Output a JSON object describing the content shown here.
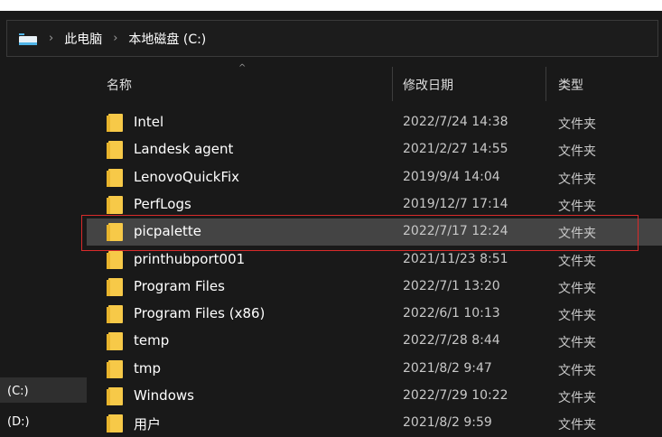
{
  "breadcrumb": {
    "items": [
      "此电脑",
      "本地磁盘 (C:)"
    ]
  },
  "columns": {
    "name": "名称",
    "date": "修改日期",
    "type": "类型"
  },
  "sidebar": {
    "drives": [
      "(C:)",
      "(D:)"
    ]
  },
  "files": [
    {
      "name": "Intel",
      "date": "2022/7/24 14:38",
      "type": "文件夹"
    },
    {
      "name": "Landesk agent",
      "date": "2021/2/27 14:55",
      "type": "文件夹"
    },
    {
      "name": "LenovoQuickFix",
      "date": "2019/9/4 14:04",
      "type": "文件夹"
    },
    {
      "name": "PerfLogs",
      "date": "2019/12/7 17:14",
      "type": "文件夹"
    },
    {
      "name": "picpalette",
      "date": "2022/7/17 12:24",
      "type": "文件夹"
    },
    {
      "name": "printhubport001",
      "date": "2021/11/23 8:51",
      "type": "文件夹"
    },
    {
      "name": "Program Files",
      "date": "2022/7/1 13:20",
      "type": "文件夹"
    },
    {
      "name": "Program Files (x86)",
      "date": "2022/6/1 10:13",
      "type": "文件夹"
    },
    {
      "name": "temp",
      "date": "2022/7/28 8:44",
      "type": "文件夹"
    },
    {
      "name": "tmp",
      "date": "2021/8/2 9:47",
      "type": "文件夹"
    },
    {
      "name": "Windows",
      "date": "2022/7/29 10:22",
      "type": "文件夹"
    },
    {
      "name": "用户",
      "date": "2021/8/2 9:59",
      "type": "文件夹"
    }
  ],
  "selected_index": 4,
  "colors": {
    "folder": "#f7c948",
    "highlight": "#d92b2b",
    "selection": "#444444"
  }
}
